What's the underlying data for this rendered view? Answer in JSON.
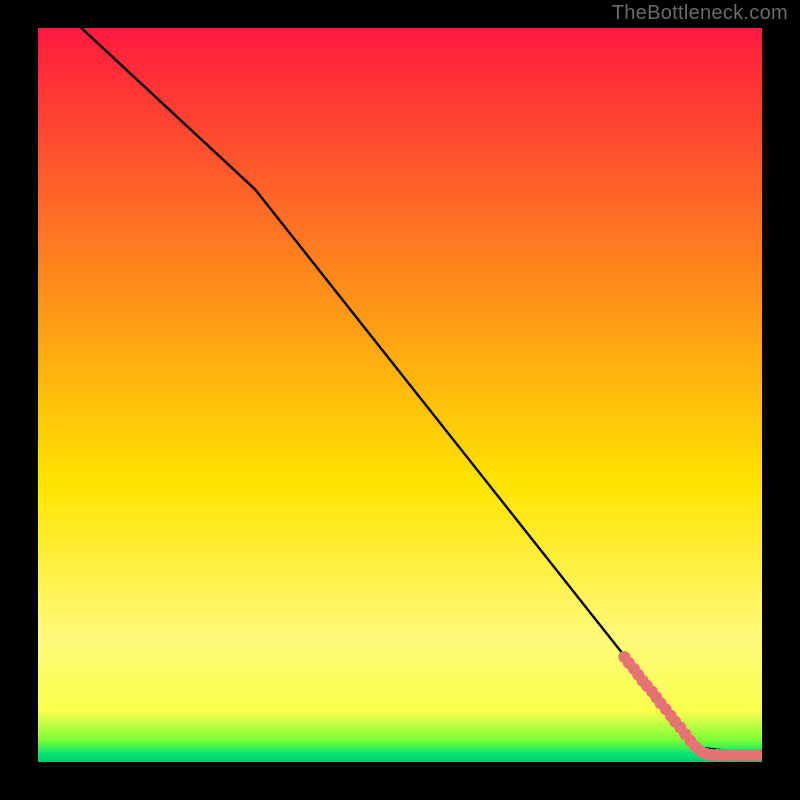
{
  "watermark": "TheBottleneck.com",
  "chart_data": {
    "type": "line",
    "title": "",
    "xlabel": "",
    "ylabel": "",
    "xlim": [
      0,
      100
    ],
    "ylim": [
      0,
      100
    ],
    "line_series": {
      "name": "curve",
      "x": [
        6,
        30,
        91,
        100
      ],
      "y": [
        100,
        78,
        2,
        1
      ]
    },
    "scatter_series": {
      "name": "points",
      "points": [
        {
          "x": 81.0,
          "y": 14.3
        },
        {
          "x": 81.6,
          "y": 13.5
        },
        {
          "x": 82.3,
          "y": 12.7
        },
        {
          "x": 82.9,
          "y": 11.9
        },
        {
          "x": 83.5,
          "y": 11.1
        },
        {
          "x": 84.1,
          "y": 10.4
        },
        {
          "x": 84.8,
          "y": 9.6
        },
        {
          "x": 85.4,
          "y": 8.8
        },
        {
          "x": 86.0,
          "y": 8.0
        },
        {
          "x": 86.7,
          "y": 7.2
        },
        {
          "x": 87.4,
          "y": 6.3
        },
        {
          "x": 88.0,
          "y": 5.5
        },
        {
          "x": 88.7,
          "y": 4.7
        },
        {
          "x": 89.4,
          "y": 3.8
        },
        {
          "x": 90.1,
          "y": 2.9
        },
        {
          "x": 90.8,
          "y": 2.1
        },
        {
          "x": 91.5,
          "y": 1.5
        },
        {
          "x": 92.3,
          "y": 1.1
        },
        {
          "x": 93.0,
          "y": 1.0
        },
        {
          "x": 93.8,
          "y": 1.0
        },
        {
          "x": 94.5,
          "y": 1.0
        },
        {
          "x": 95.2,
          "y": 1.0
        },
        {
          "x": 96.0,
          "y": 1.0
        },
        {
          "x": 96.8,
          "y": 1.0
        },
        {
          "x": 97.5,
          "y": 1.0
        },
        {
          "x": 98.2,
          "y": 1.0
        },
        {
          "x": 99.0,
          "y": 1.0
        },
        {
          "x": 99.7,
          "y": 1.0
        }
      ]
    },
    "gradient_colors": {
      "top": "#ff1a3e",
      "mid": "#ffe400",
      "green1": "#7cff37",
      "green2": "#00e478",
      "bottom": "#00c96b"
    },
    "line_color": "#000000",
    "dot_color": "#e57373",
    "dot_radius": 6
  }
}
